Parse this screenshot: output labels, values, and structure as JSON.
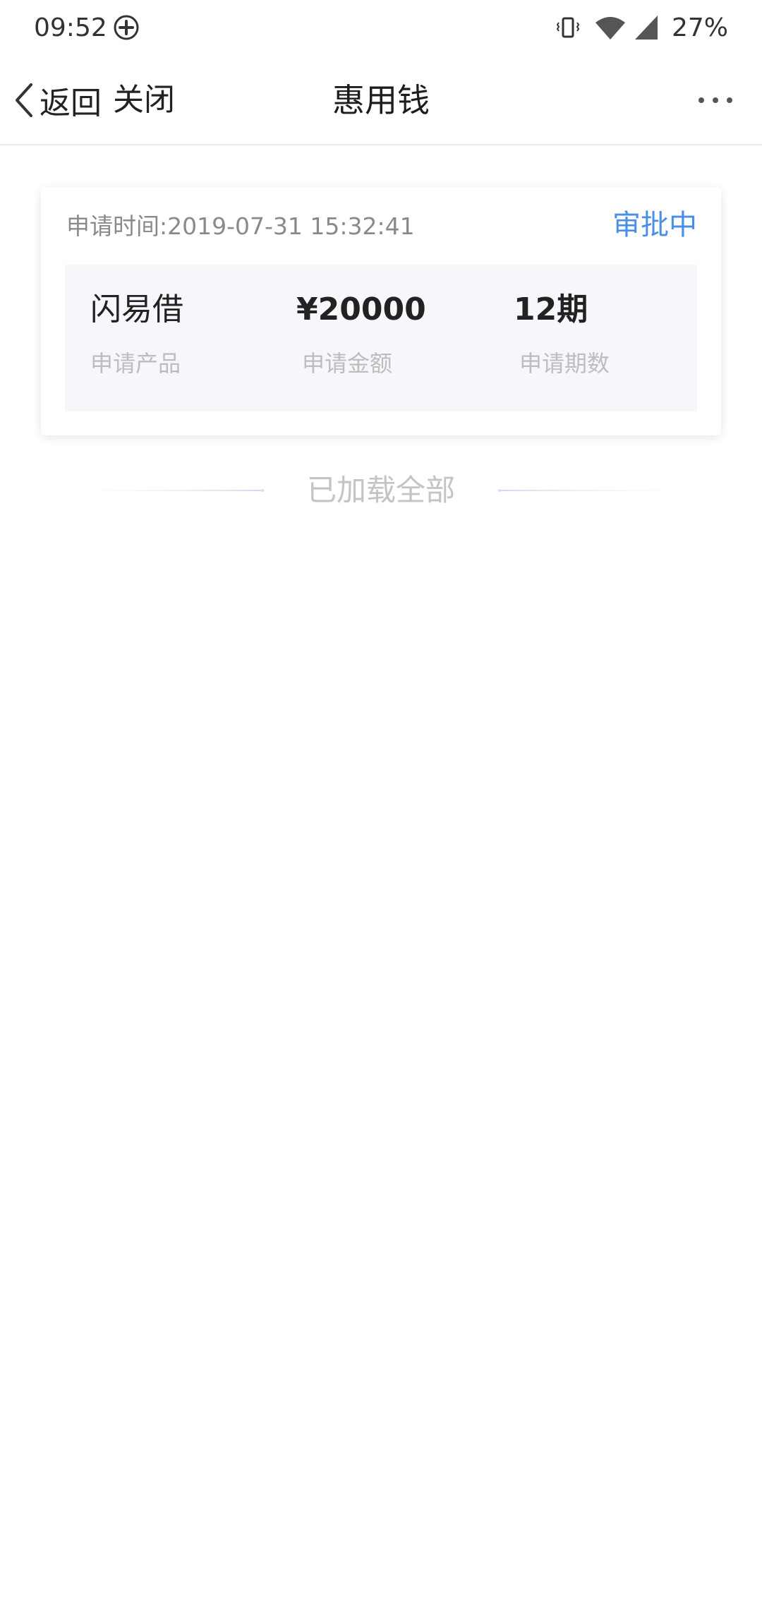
{
  "status_bar": {
    "time": "09:52",
    "battery": "27%",
    "icons": [
      "app-plus-icon",
      "vibrate-icon",
      "wifi-icon",
      "signal-icon"
    ]
  },
  "nav": {
    "back_label": "返回",
    "close_label": "关闭",
    "title": "惠用钱",
    "more_icon": "more-dots-icon"
  },
  "application": {
    "time_text": "申请时间:2019-07-31 15:32:41",
    "status": "审批中",
    "status_color": "#4a8ee6",
    "product_value": "闪易借",
    "product_label": "申请产品",
    "amount_value": "¥20000",
    "amount_label": "申请金额",
    "periods_value": "12期",
    "periods_label": "申请期数"
  },
  "footer": {
    "loaded_all": "已加载全部"
  }
}
